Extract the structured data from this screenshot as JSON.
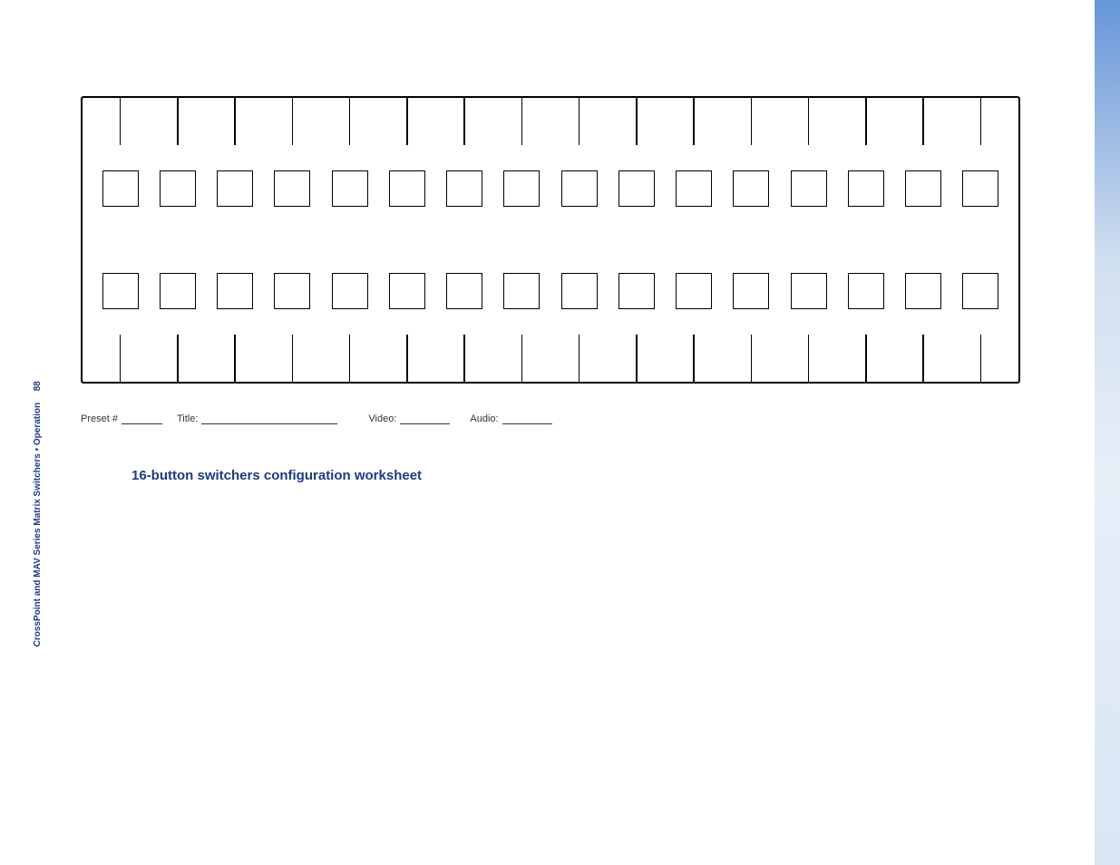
{
  "heading": "16-button switchers configuration worksheet",
  "sidebarText": "CrossPoint and MAV Series Matrix Switchers • Operation",
  "pageNumber": "88",
  "form": {
    "label1": "Preset #",
    "label2": "Title:",
    "label3": "Video:",
    "label4": "Audio:"
  },
  "diagram": {
    "ticks": 16,
    "boxes": 16
  }
}
